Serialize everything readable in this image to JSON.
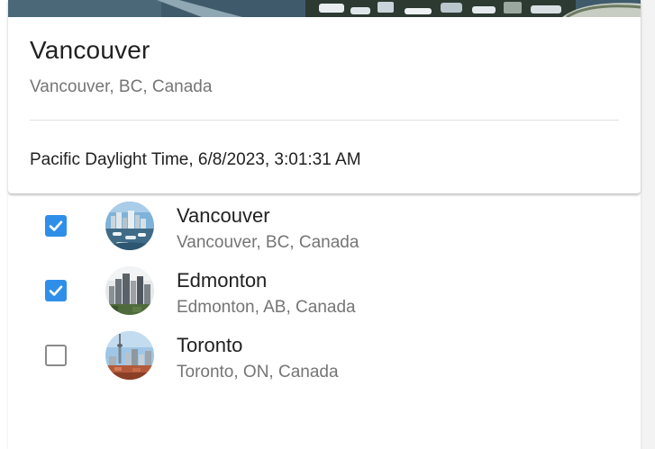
{
  "card": {
    "title": "Vancouver",
    "subtitle": "Vancouver, BC, Canada",
    "timestamp": "Pacific Daylight Time, 6/8/2023, 3:01:31 AM"
  },
  "cities": [
    {
      "name": "Vancouver",
      "location": "Vancouver, BC, Canada",
      "checked": true,
      "icon": "vancouver-photo"
    },
    {
      "name": "Edmonton",
      "location": "Edmonton, AB, Canada",
      "checked": true,
      "icon": "edmonton-photo"
    },
    {
      "name": "Toronto",
      "location": "Toronto, ON, Canada",
      "checked": false,
      "icon": "toronto-photo"
    }
  ],
  "colors": {
    "accent": "#2f8fe8",
    "text": "#212121",
    "secondary": "#757575",
    "divider": "#e0e0e0"
  }
}
